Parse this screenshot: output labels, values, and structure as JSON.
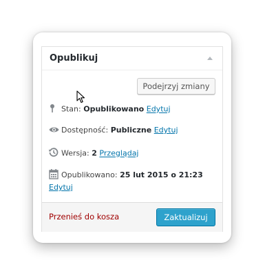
{
  "box": {
    "title": "Opublikuj",
    "toggle_icon": "arrow-up-icon"
  },
  "preview_button": "Podejrzyj zmiany",
  "status": {
    "icon": "pin-icon",
    "label": "Stan:",
    "value": "Opublikowano",
    "edit": "Edytuj"
  },
  "visibility": {
    "icon": "eye-icon",
    "label": "Dostępność:",
    "value": "Publiczne",
    "edit": "Edytuj"
  },
  "revisions": {
    "icon": "history-icon",
    "label": "Wersja:",
    "value": "2",
    "browse": "Przeglądaj"
  },
  "published": {
    "icon": "calendar-icon",
    "label": "Opublikowano:",
    "value": "25 lut 2015 o 21:23",
    "edit": "Edytuj"
  },
  "footer": {
    "trash": "Przenieś do kosza",
    "update": "Zaktualizuj"
  },
  "colors": {
    "link": "#0073aa",
    "trash": "#a00000",
    "primary_button": "#2ea2cc"
  }
}
